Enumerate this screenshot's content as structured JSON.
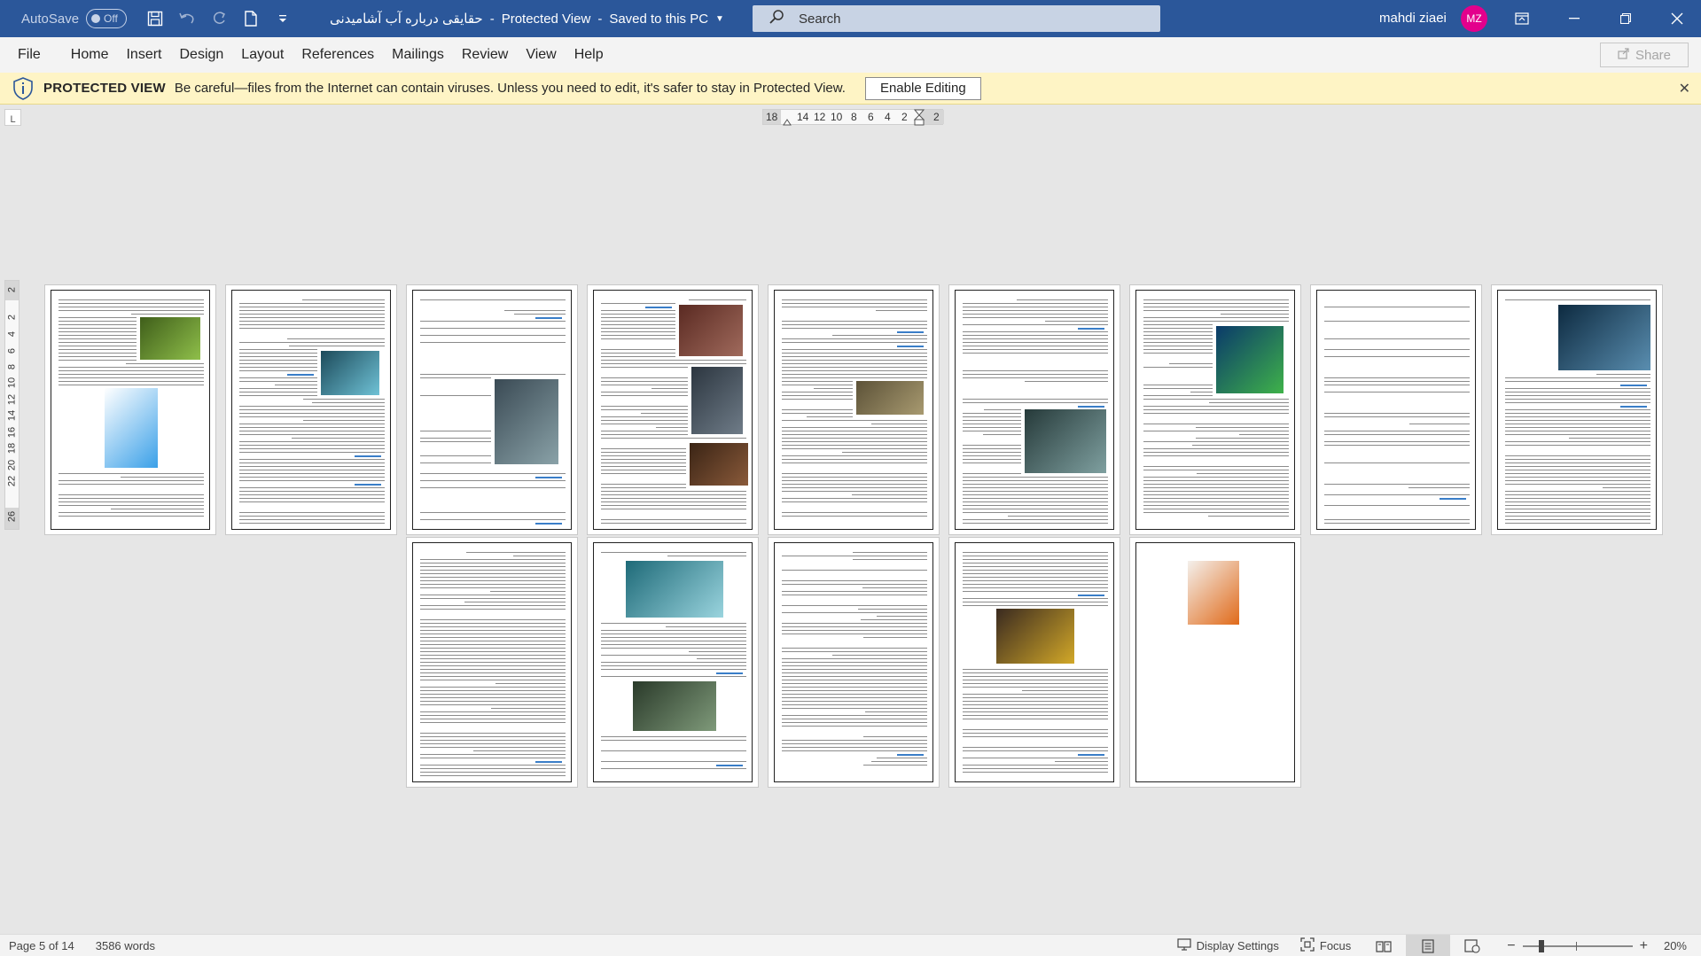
{
  "titlebar": {
    "autosave_label": "AutoSave",
    "autosave_state": "Off",
    "doc_name": "حقایقی درباره آب آشامیدنی",
    "separator": "-",
    "view_mode": "Protected View",
    "separator2": "-",
    "save_status": "Saved to this PC",
    "search_placeholder": "Search",
    "user_name": "mahdi ziaei",
    "user_initials": "MZ",
    "accent_color": "#2b579a"
  },
  "menu": {
    "items": [
      "File",
      "Home",
      "Insert",
      "Design",
      "Layout",
      "References",
      "Mailings",
      "Review",
      "View",
      "Help"
    ],
    "share_label": "Share"
  },
  "protected_view": {
    "label": "PROTECTED VIEW",
    "message": "Be careful—files from the Internet can contain viruses. Unless you need to edit, it's safer to stay in Protected View.",
    "enable_button": "Enable Editing",
    "close_icon": "close-icon"
  },
  "ruler": {
    "h_labels": [
      "18",
      "14",
      "12",
      "10",
      "8",
      "6",
      "4",
      "2",
      "2"
    ],
    "v_labels": [
      "2",
      "2",
      "4",
      "6",
      "8",
      "10",
      "12",
      "14",
      "16",
      "18",
      "20",
      "22",
      "26"
    ],
    "corner_symbol": "L"
  },
  "status": {
    "page_info": "Page 5 of 14",
    "word_count": "3586 words",
    "display_settings": "Display Settings",
    "focus": "Focus",
    "zoom": "20%",
    "zoom_minus": "−",
    "zoom_plus": "+"
  }
}
